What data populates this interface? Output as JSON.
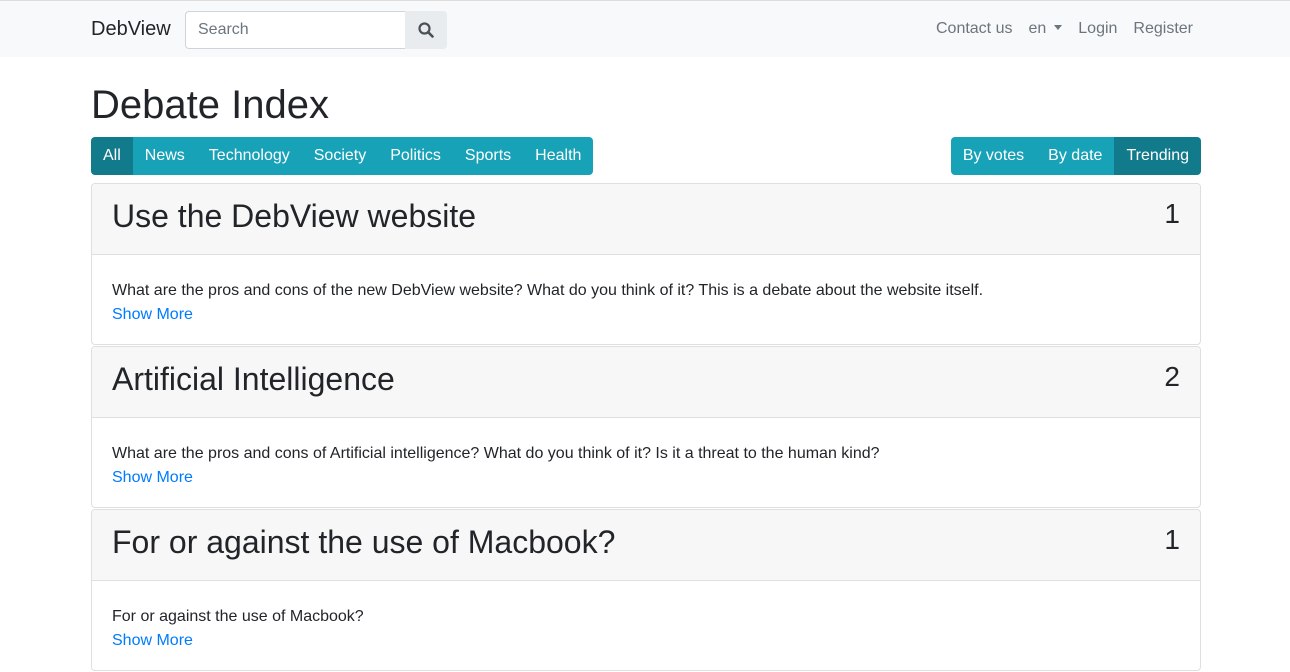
{
  "navbar": {
    "brand": "DebView",
    "search_placeholder": "Search",
    "search_icon": "search-icon",
    "contact": "Contact us",
    "language": "en",
    "login": "Login",
    "register": "Register"
  },
  "page": {
    "title": "Debate Index"
  },
  "categories": [
    "All",
    "News",
    "Technology",
    "Society",
    "Politics",
    "Sports",
    "Health"
  ],
  "sort_options": [
    "By votes",
    "By date",
    "Trending"
  ],
  "active_category": "All",
  "active_sort": "Trending",
  "colors": {
    "accent": "#17a2b8",
    "accent_active": "#117a8b",
    "link": "#007bff"
  },
  "debates": [
    {
      "title": "Use the DebView website",
      "count": "1",
      "description": "What are the pros and cons of the new DebView website? What do you think of it? This is a debate about the website itself.",
      "link": "Show More"
    },
    {
      "title": "Artificial Intelligence",
      "count": "2",
      "description": "What are the pros and cons of Artificial intelligence? What do you think of it? Is it a threat to the human kind?",
      "link": "Show More"
    },
    {
      "title": "For or against the use of Macbook?",
      "count": "1",
      "description": "For or against the use of Macbook?",
      "link": "Show More"
    }
  ]
}
